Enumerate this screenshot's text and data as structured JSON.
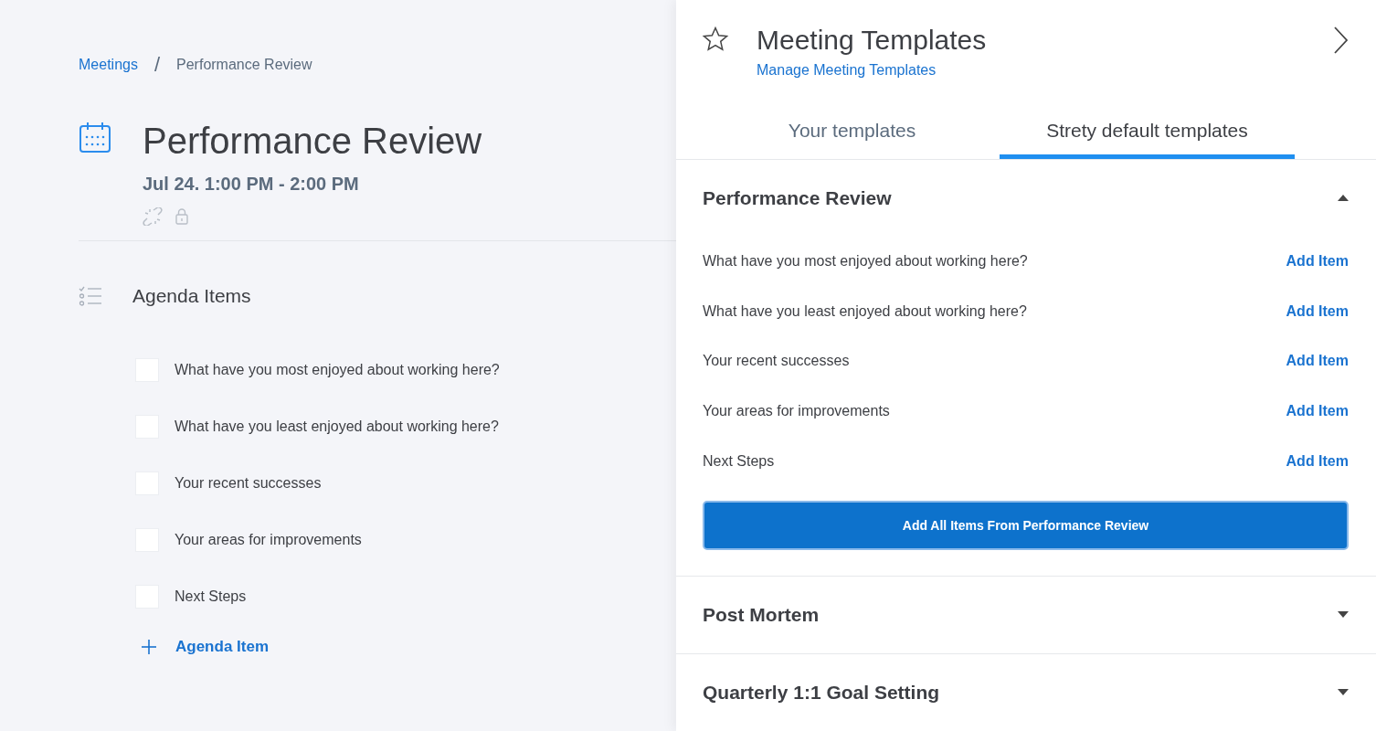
{
  "breadcrumb_separator": "/",
  "breadcrumb": [
    {
      "label": "Meetings",
      "kind": "link"
    },
    {
      "label": "Performance Review",
      "kind": "current"
    }
  ],
  "meeting": {
    "title": "Performance Review",
    "time": "Jul 24. 1:00 PM - 2:00 PM"
  },
  "agenda": {
    "heading": "Agenda Items",
    "items": [
      {
        "text": "What have you most enjoyed about working here?",
        "checked": false
      },
      {
        "text": "What have you least enjoyed about working here?",
        "checked": false
      },
      {
        "text": "Your recent successes",
        "checked": false
      },
      {
        "text": "Your areas for improvements",
        "checked": false
      },
      {
        "text": "Next Steps",
        "checked": false
      }
    ],
    "add_label": "Agenda Item"
  },
  "panel": {
    "title": "Meeting Templates",
    "manage_link": "Manage Meeting Templates",
    "tabs": [
      {
        "label": "Your templates",
        "selected": false
      },
      {
        "label": "Strety default templates",
        "selected": true
      }
    ],
    "templates": [
      {
        "name": "Performance Review",
        "expanded": true,
        "items": [
          {
            "text": "What have you most enjoyed about working here?",
            "action": "Add Item"
          },
          {
            "text": "What have you least enjoyed about working here?",
            "action": "Add Item"
          },
          {
            "text": "Your recent successes",
            "action": "Add Item"
          },
          {
            "text": "Your areas for improvements",
            "action": "Add Item"
          },
          {
            "text": "Next Steps",
            "action": "Add Item"
          }
        ],
        "add_all": "Add All Items From Performance Review"
      },
      {
        "name": "Post Mortem",
        "expanded": false
      },
      {
        "name": "Quarterly 1:1 Goal Setting",
        "expanded": false
      }
    ]
  }
}
